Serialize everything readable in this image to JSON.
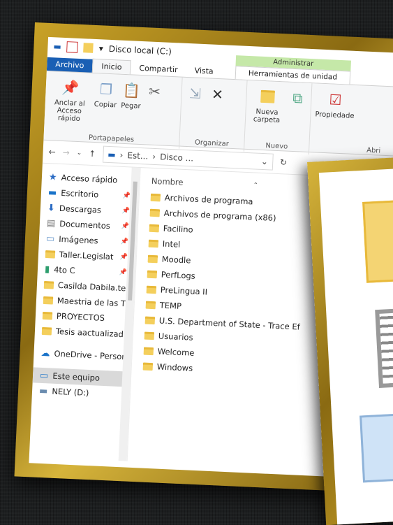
{
  "window": {
    "title": "Disco local (C:)"
  },
  "tabs": {
    "file": "Archivo",
    "home": "Inicio",
    "share": "Compartir",
    "view": "Vista"
  },
  "context_tab": {
    "header": "Administrar",
    "subtab": "Herramientas de unidad"
  },
  "ribbon": {
    "pin": "Anclar al Acceso rápido",
    "copy": "Copiar",
    "paste": "Pegar",
    "clipboard_group": "Portapapeles",
    "organize_group": "Organizar",
    "new_folder": "Nueva carpeta",
    "new_group": "Nuevo",
    "properties": "Propiedade",
    "open_group": "Abri"
  },
  "address": {
    "seg1": "Est...",
    "seg2": "Disco ..."
  },
  "nav": [
    {
      "label": "Acceso rápido",
      "icon": "star-icon",
      "pinned": false
    },
    {
      "label": "Escritorio",
      "icon": "desktop-icon",
      "pinned": true
    },
    {
      "label": "Descargas",
      "icon": "download-icon",
      "pinned": true
    },
    {
      "label": "Documentos",
      "icon": "document-icon",
      "pinned": true
    },
    {
      "label": "Imágenes",
      "icon": "pictures-icon",
      "pinned": true
    },
    {
      "label": "Taller.Legislat",
      "icon": "folder-icon",
      "pinned": true
    },
    {
      "label": "4to C",
      "icon": "green-folder-icon",
      "pinned": true
    },
    {
      "label": "Casilda Dabila.te",
      "icon": "folder-icon",
      "pinned": false
    },
    {
      "label": "Maestria de las T",
      "icon": "folder-icon",
      "pinned": false
    },
    {
      "label": "PROYECTOS",
      "icon": "folder-icon",
      "pinned": false
    },
    {
      "label": "Tesis aactualizad",
      "icon": "folder-icon",
      "pinned": false
    },
    {
      "label": "OneDrive - Persor",
      "icon": "onedrive-icon",
      "pinned": false
    },
    {
      "label": "Este equipo",
      "icon": "computer-icon",
      "pinned": false
    },
    {
      "label": "NELY (D:)",
      "icon": "drive-icon",
      "pinned": false
    }
  ],
  "file_list": {
    "column_name": "Nombre",
    "items": [
      "Archivos de programa",
      "Archivos de programa (x86)",
      "Facilino",
      "Intel",
      "Moodle",
      "PerfLogs",
      "PreLingua II",
      "TEMP",
      "U.S. Department of State - Trace Ef",
      "Usuarios",
      "Welcome",
      "Windows"
    ]
  }
}
